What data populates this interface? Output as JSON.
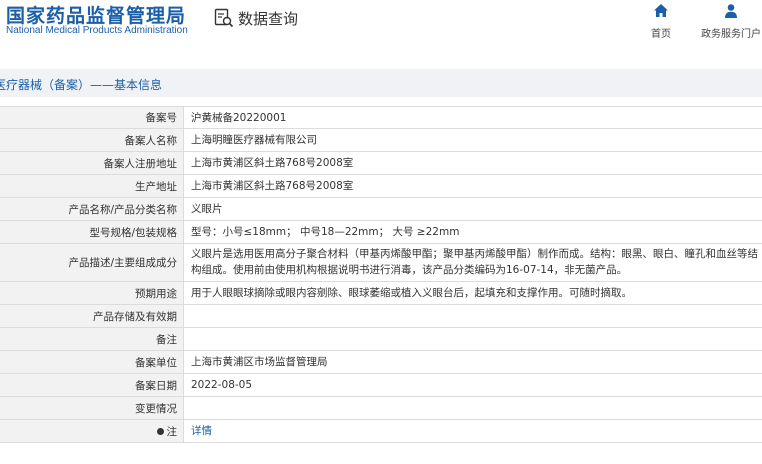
{
  "header": {
    "logo_zh": "国家药品监督管理局",
    "logo_en": "National Medical Products Administration",
    "search_title": "数据查询",
    "nav": [
      {
        "label": "首页",
        "icon": "home-icon"
      },
      {
        "label": "政务服务门户",
        "icon": "user-icon"
      }
    ]
  },
  "section": {
    "title": "医疗器械（备案）——基本信息"
  },
  "colors": {
    "brand": "#1b5fa8",
    "label_bg": "#f2f2f2",
    "section_bg": "#f0f2f5",
    "border": "#dcdcdc"
  },
  "rows": [
    {
      "label": "备案号",
      "value": "沪黄械备20220001"
    },
    {
      "label": "备案人名称",
      "value": "上海明瞳医疗器械有限公司"
    },
    {
      "label": "备案人注册地址",
      "value": "上海市黄浦区斜土路768号2008室"
    },
    {
      "label": "生产地址",
      "value": "上海市黄浦区斜土路768号2008室"
    },
    {
      "label": "产品名称/产品分类名称",
      "value": "义眼片"
    },
    {
      "label": "型号规格/包装规格",
      "value": "型号：小号≤18mm； 中号18—22mm； 大号 ≥22mm"
    },
    {
      "label": "产品描述/主要组成成分",
      "value": "义眼片是选用医用高分子聚合材料（甲基丙烯酸甲酯；聚甲基丙烯酸甲酯）制作而成。结构：眼黑、眼白、瞳孔和血丝等结构组成。使用前由使用机构根据说明书进行消毒，该产品分类编码为16-07-14，非无菌产品。"
    },
    {
      "label": "预期用途",
      "value": "用于人眼眼球摘除或眼内容剜除、眼球萎缩或植入义眼台后，起填充和支撑作用。可随时摘取。"
    },
    {
      "label": "产品存储及有效期",
      "value": ""
    },
    {
      "label": "备注",
      "value": ""
    },
    {
      "label": "备案单位",
      "value": "上海市黄浦区市场监督管理局"
    },
    {
      "label": "备案日期",
      "value": "2022-08-05"
    },
    {
      "label": "变更情况",
      "value": ""
    },
    {
      "label": "注",
      "value": "详情"
    }
  ]
}
